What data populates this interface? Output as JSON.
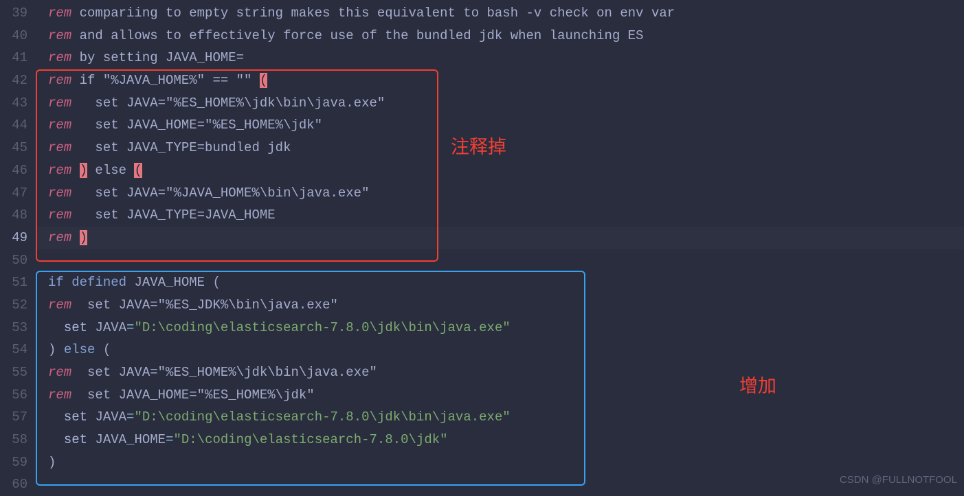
{
  "watermark": "CSDN @FULLNOTFOOL",
  "annotations": {
    "a1": "注释掉",
    "a2": "增加"
  },
  "gutter": {
    "start": 39,
    "end": 60,
    "active": 49
  },
  "lines": {
    "l39": {
      "rem": "rem",
      "t": " compariing to empty string makes this equivalent to bash -v check on env var"
    },
    "l40": {
      "rem": "rem",
      "t": " and allows to effectively force use of the bundled jdk when launching ES"
    },
    "l41": {
      "rem": "rem",
      "t": " by setting JAVA_HOME="
    },
    "l42": {
      "rem": "rem",
      "t1": " if \"%JAVA_HOME%\" == \"\" ",
      "p": "("
    },
    "l43": {
      "rem": "rem",
      "t": "   set JAVA=\"%ES_HOME%\\jdk\\bin\\java.exe\""
    },
    "l44": {
      "rem": "rem",
      "t": "   set JAVA_HOME=\"%ES_HOME%\\jdk\""
    },
    "l45": {
      "rem": "rem",
      "t": "   set JAVA_TYPE=bundled jdk"
    },
    "l46": {
      "rem": "rem",
      "sp": " ",
      "p1": ")",
      "t1": " else ",
      "p2": "("
    },
    "l47": {
      "rem": "rem",
      "t": "   set JAVA=\"%JAVA_HOME%\\bin\\java.exe\""
    },
    "l48": {
      "rem": "rem",
      "t": "   set JAVA_TYPE=JAVA_HOME"
    },
    "l49": {
      "rem": "rem",
      "sp": " ",
      "p": ")"
    },
    "l51": {
      "kw1": "if",
      "sp1": " ",
      "kw2": "defined",
      "sp2": " ",
      "id": "JAVA_HOME ",
      "p": "("
    },
    "l52": {
      "rem": "rem",
      "t": "  set JAVA=\"%ES_JDK%\\bin\\java.exe\""
    },
    "l53": {
      "ind": "  ",
      "set": "set",
      "sp": " ",
      "id": "JAVA",
      "eq": "=",
      "str": "\"D:\\coding\\elasticsearch-7.8.0\\jdk\\bin\\java.exe\""
    },
    "l54": {
      "p1": ")",
      "sp": " ",
      "kw": "else",
      "sp2": " ",
      "p2": "("
    },
    "l55": {
      "rem": "rem",
      "t": "  set JAVA=\"%ES_HOME%\\jdk\\bin\\java.exe\""
    },
    "l56": {
      "rem": "rem",
      "t": "  set JAVA_HOME=\"%ES_HOME%\\jdk\""
    },
    "l57": {
      "ind": "  ",
      "set": "set",
      "sp": " ",
      "id": "JAVA",
      "eq": "=",
      "str": "\"D:\\coding\\elasticsearch-7.8.0\\jdk\\bin\\java.exe\""
    },
    "l58": {
      "ind": "  ",
      "set": "set",
      "sp": " ",
      "id": "JAVA_HOME",
      "eq": "=",
      "str": "\"D:\\coding\\elasticsearch-7.8.0\\jdk\""
    },
    "l59": {
      "p": ")"
    }
  }
}
